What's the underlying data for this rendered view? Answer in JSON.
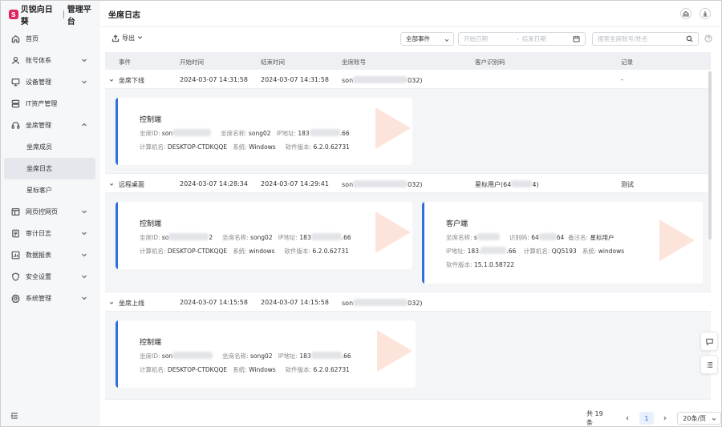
{
  "app": {
    "brand_name": "贝锐向日葵",
    "brand_suffix": "管理平台",
    "brand_color": "#e0245e",
    "accent_color": "#2f6fe0",
    "page_title": "坐席日志"
  },
  "sidebar": {
    "items": [
      {
        "label": "首页",
        "icon": "home-icon"
      },
      {
        "label": "账号体系",
        "icon": "user-icon",
        "expandable": true
      },
      {
        "label": "设备管理",
        "icon": "monitor-icon",
        "expandable": true
      },
      {
        "label": "IT资产管理",
        "icon": "server-icon"
      },
      {
        "label": "坐席管理",
        "icon": "headset-icon",
        "expandable": true,
        "expanded": true
      },
      {
        "label": "坐席成员",
        "sub": true
      },
      {
        "label": "坐席日志",
        "sub": true,
        "active": true
      },
      {
        "label": "星标客户",
        "sub": true
      },
      {
        "label": "网页控网页",
        "icon": "web-icon",
        "expandable": true
      },
      {
        "label": "审计日志",
        "icon": "audit-icon",
        "expandable": true
      },
      {
        "label": "数据报表",
        "icon": "report-icon",
        "expandable": true
      },
      {
        "label": "安全设置",
        "icon": "shield-icon",
        "expandable": true
      },
      {
        "label": "系统管理",
        "icon": "gear-icon",
        "expandable": true
      }
    ]
  },
  "toolbar": {
    "export_label": "导出",
    "event_filter": "全部事件",
    "start_placeholder": "开始日期",
    "range_sep": "-",
    "end_placeholder": "结束日期",
    "search_placeholder": "搜索坐席账号/姓名"
  },
  "table": {
    "headers": [
      "事件",
      "开始时间",
      "结束时间",
      "坐席账号",
      "客户识别码",
      "记录"
    ],
    "rows": [
      {
        "event": "坐席下线",
        "start": "2024-03-07 14:31:58",
        "end": "2024-03-07 14:31:58",
        "account_prefix": "son",
        "account_suffix": "032)",
        "client_code": "",
        "record": "-",
        "cards": [
          {
            "title": "控制端",
            "id_label": "坐席ID:",
            "id_prefix": "son",
            "name_label": "坐席名称:",
            "name": "song02",
            "ip_label": "IP地址:",
            "ip_prefix": "183",
            "ip_suffix": ".66",
            "host_label": "计算机名:",
            "host": "DESKTOP-CTDKQQE",
            "os_label": "系统:",
            "os": "Windows",
            "ver_label": "软件版本:",
            "ver": "6.2.0.62731"
          }
        ]
      },
      {
        "event": "远程桌面",
        "start": "2024-03-07 14:28:34",
        "end": "2024-03-07 14:29:41",
        "account_prefix": "son",
        "account_suffix": "032)",
        "client_code": "星标用户(64",
        "client_code_suffix": "4)",
        "record": "测试",
        "cards": [
          {
            "title": "控制端",
            "id_label": "坐席ID:",
            "id_prefix": "so",
            "id_suffix": "2",
            "name_label": "坐席名称:",
            "name": "song02",
            "ip_label": "IP地址:",
            "ip_prefix": "183",
            "ip_suffix": ".66",
            "host_label": "计算机名:",
            "host": "DESKTOP-CTDKQQE",
            "os_label": "系统:",
            "os": "windows",
            "ver_label": "软件版本:",
            "ver": "6.2.0.62731"
          },
          {
            "title": "客户端",
            "name_label": "坐席名称:",
            "name_prefix": "s",
            "code_label": "识别码:",
            "code_prefix": "64",
            "code_suffix": "64",
            "note_label": "备注名:",
            "note": "星标用户",
            "ip_label": "IP地址:",
            "ip_prefix": "183.",
            "ip_suffix": ".66",
            "host_label": "计算机名:",
            "host": "QQ5193",
            "os_label": "系统:",
            "os": "windows",
            "ver_label": "软件版本:",
            "ver": "15.1.0.58722"
          }
        ]
      },
      {
        "event": "坐席上线",
        "start": "2024-03-07 14:15:58",
        "end": "2024-03-07 14:15:58",
        "account_prefix": "son",
        "account_suffix": "032)",
        "client_code": "",
        "record": "",
        "cards": [
          {
            "title": "控制端",
            "id_label": "坐席ID:",
            "id_prefix": "son",
            "name_label": "坐席名称:",
            "name": "song02",
            "ip_label": "IP地址:",
            "ip_prefix": "183",
            "ip_suffix": ".66",
            "host_label": "计算机名:",
            "host": "DESKTOP-CTDKQQE",
            "os_label": "系统:",
            "os": "Windows",
            "ver_label": "软件版本:",
            "ver": "6.2.0.62731"
          }
        ]
      }
    ]
  },
  "pagination": {
    "total": "共 19 条",
    "current": "1",
    "page_size": "20条/页"
  }
}
